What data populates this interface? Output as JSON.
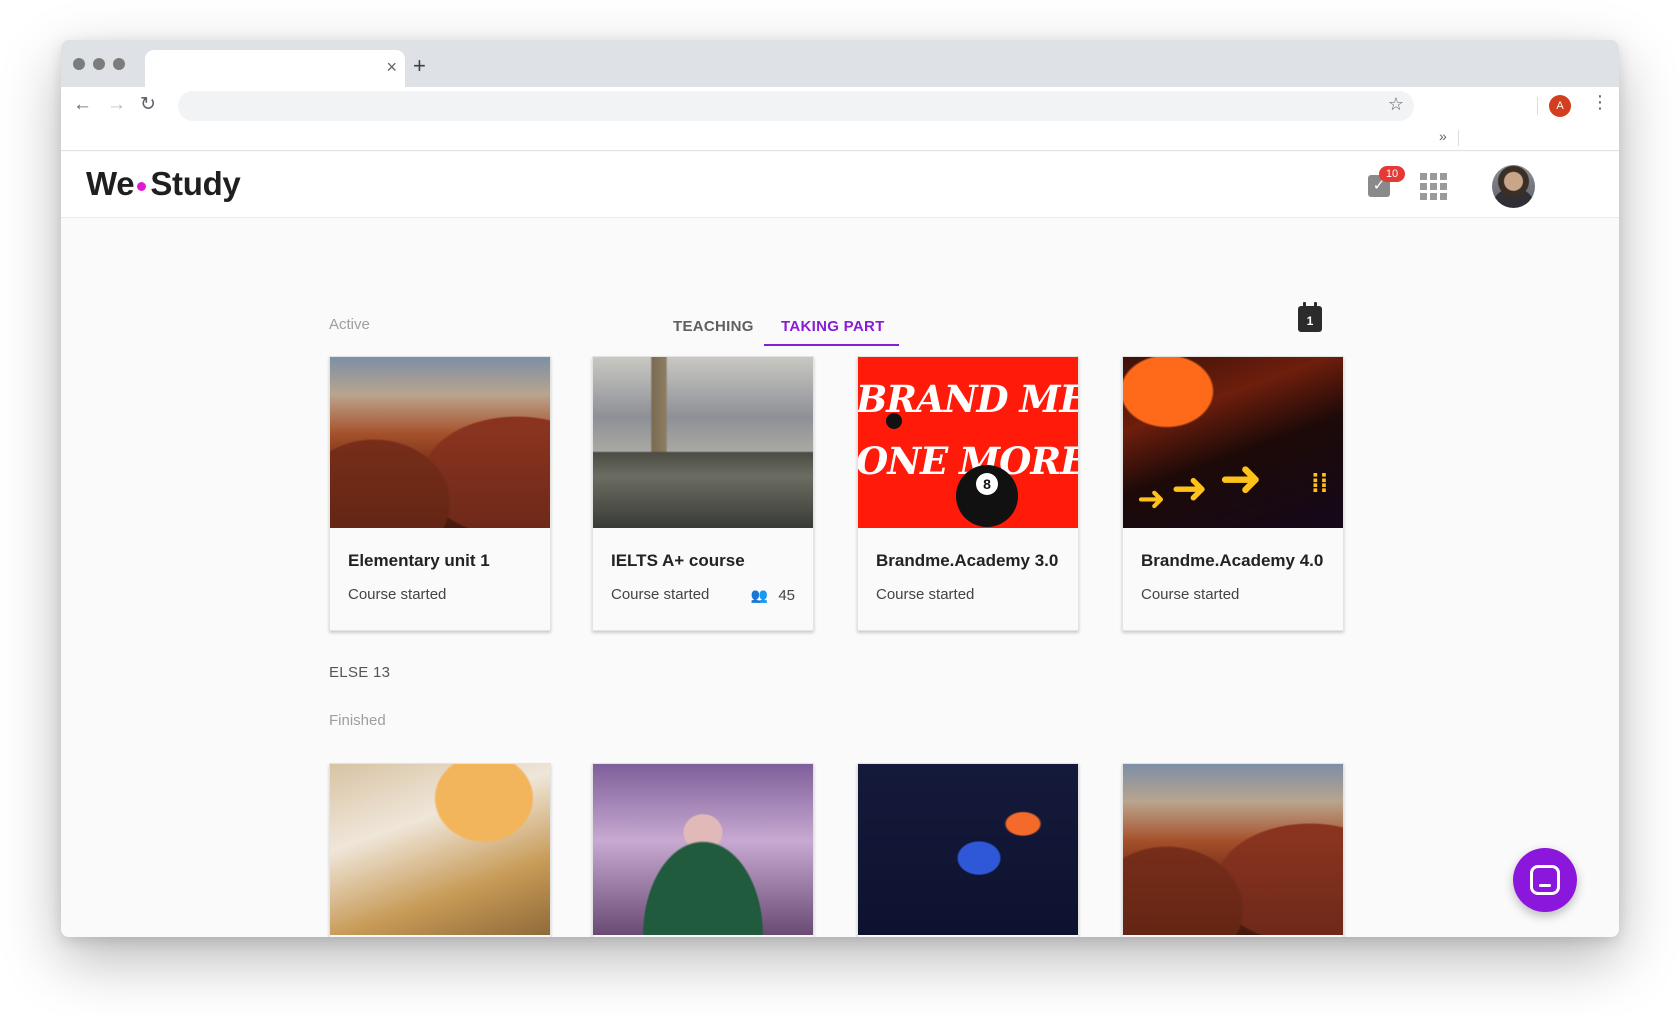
{
  "browser": {
    "tab_close": "×",
    "new_tab": "+",
    "back": "←",
    "forward": "→",
    "reload": "↻",
    "star": "☆",
    "profile_initial": "A",
    "menu": "⋮",
    "bookmarks_overflow": "»"
  },
  "app": {
    "logo_left": "We",
    "logo_right": "Study",
    "notifications_count": "10",
    "brand_color": "#8a1cd6",
    "logo_dot_color": "#e21ad8"
  },
  "active_section": {
    "label": "Active",
    "tabs": [
      {
        "label": "TEACHING",
        "active": false
      },
      {
        "label": "TAKING PART",
        "active": true
      }
    ],
    "calendar_day": "1",
    "courses": [
      {
        "title": "Elementary unit 1",
        "status": "Course started",
        "participants": null,
        "image": "canyon"
      },
      {
        "title": "IELTS A+ course",
        "status": "Course started",
        "participants": "45",
        "image": "london"
      },
      {
        "title": "Brandme.Academy 3.0",
        "status": "Course started",
        "participants": null,
        "image": "brand-me-baby"
      },
      {
        "title": "Brandme.Academy 4.0",
        "status": "Course started",
        "participants": null,
        "image": "led-arrows"
      }
    ]
  },
  "else_label": "ELSE 13",
  "finished_section": {
    "label": "Finished",
    "courses": [
      {
        "image": "desk-documents"
      },
      {
        "image": "family-portrait"
      },
      {
        "image": "pixel-art"
      },
      {
        "image": "canyon"
      }
    ]
  },
  "brand_image_text": [
    "BRAND ME BAB",
    "ONE MORE TIM"
  ]
}
